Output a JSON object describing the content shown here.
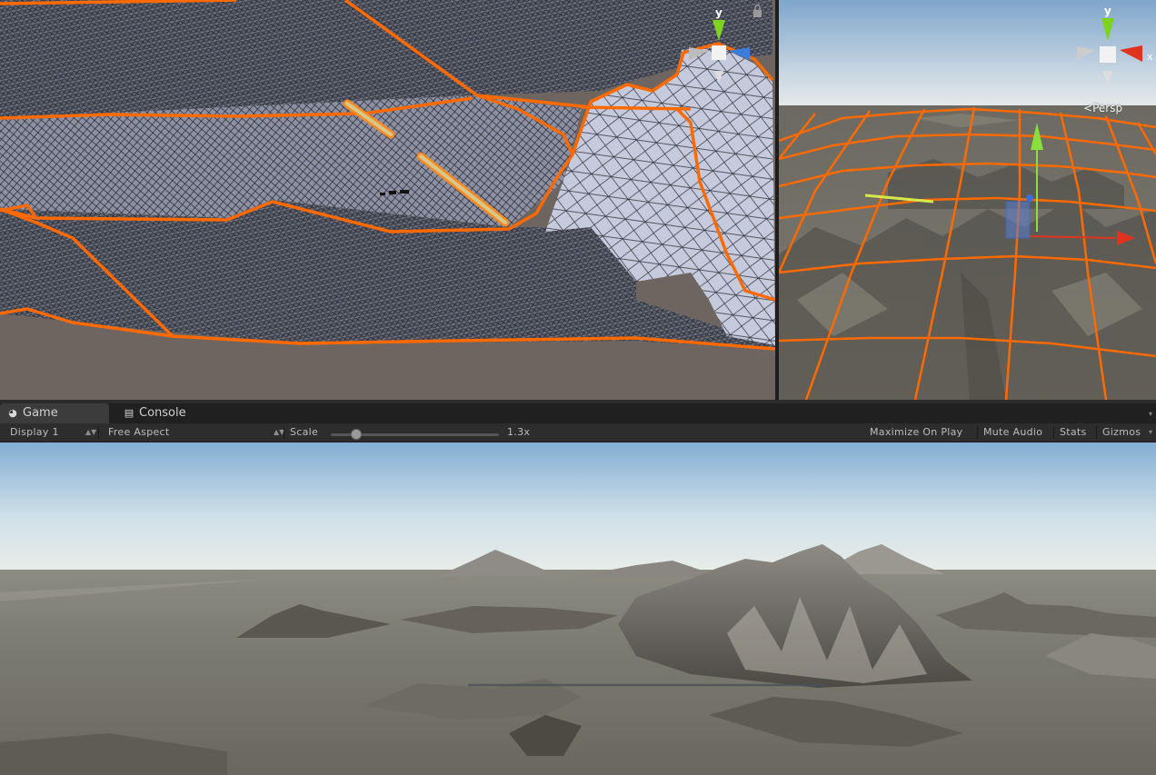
{
  "scene_view_left": {
    "mode": "wireframe",
    "accent": "#ff6a00"
  },
  "scene_view_right": {
    "projection_label": "Persp",
    "gizmo": {
      "axis_y": "y",
      "axis_x": "x"
    },
    "accent": "#ff6a00"
  },
  "tabs": [
    {
      "label": "Game",
      "icon": "game-controller-icon",
      "active": true
    },
    {
      "label": "Console",
      "icon": "console-icon",
      "active": false
    }
  ],
  "toolbar": {
    "display": "Display 1",
    "aspect": "Free Aspect",
    "scale_label": "Scale",
    "scale_value": "1.3x",
    "maximize": "Maximize On Play",
    "mute": "Mute Audio",
    "stats": "Stats",
    "gizmos": "Gizmos"
  },
  "colors": {
    "selection_outline": "#ff6a00",
    "sky_top": "#8fb3d6",
    "ground": "#7a776c"
  }
}
